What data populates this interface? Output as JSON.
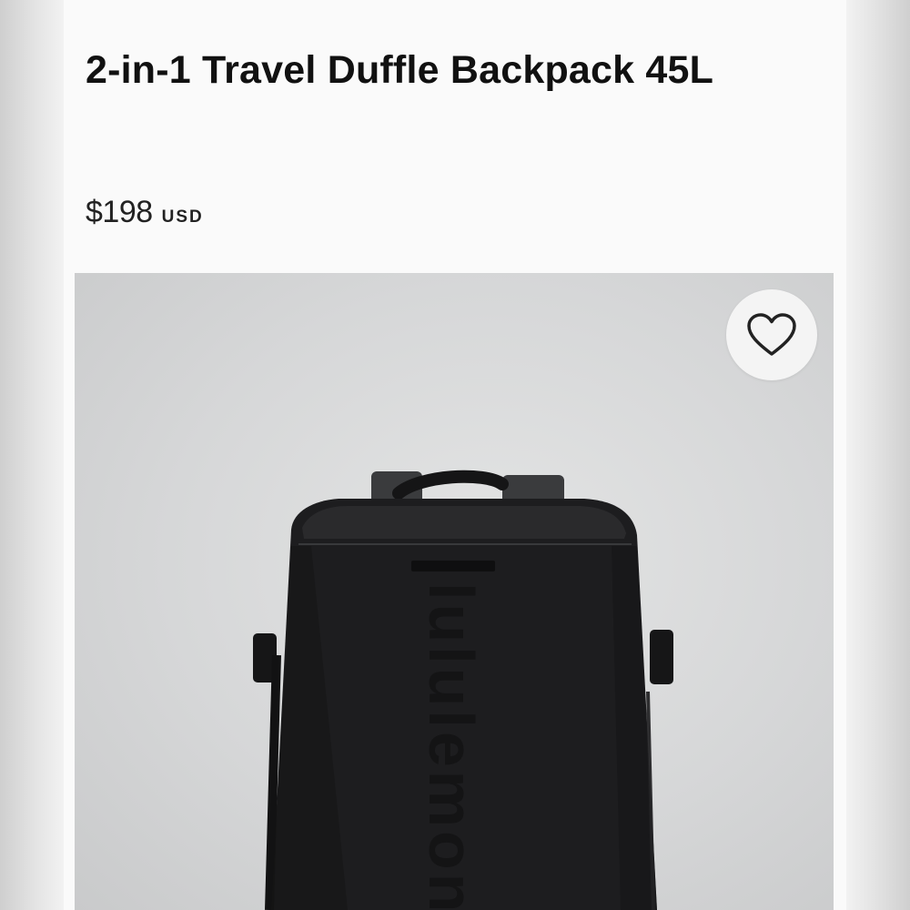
{
  "product": {
    "title": "2-in-1 Travel Duffle Backpack 45L",
    "price": "$198",
    "currency": "USD"
  },
  "image": {
    "subject": "black travel duffle backpack",
    "embossed_logo_text": "lululemon"
  },
  "icons": {
    "wishlist": "heart-outline-icon"
  },
  "colors": {
    "background": "#fafafa",
    "text": "#111111",
    "bag": "#1b1b1d",
    "image_background": "#d6d7d8"
  }
}
